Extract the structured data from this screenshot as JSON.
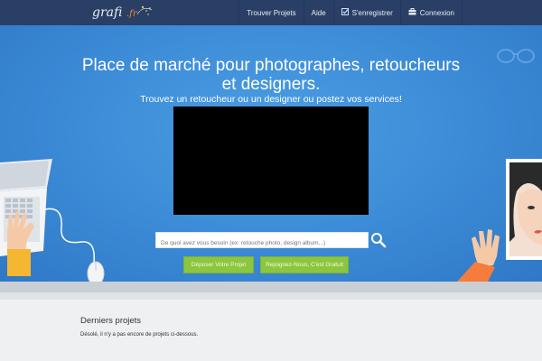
{
  "brand": {
    "logo_text": "grafi.fr"
  },
  "nav": {
    "items": [
      {
        "label": "Trouver Projets",
        "icon": ""
      },
      {
        "label": "Aide",
        "icon": ""
      },
      {
        "label": "S'enregistrer",
        "icon": "checkbox-icon"
      },
      {
        "label": "Connexion",
        "icon": "briefcase-icon"
      }
    ]
  },
  "hero": {
    "title_line1": "Place de marché pour photographes, retoucheurs",
    "title_line2": "et designers.",
    "subtitle": "Trouvez un retoucheur ou un designer ou postez vos services!"
  },
  "search": {
    "placeholder": "De quoi avez vous besoin (ex: retouche photo, design album...)",
    "value": ""
  },
  "buttons": {
    "post_project": "Déposer Votre Projet",
    "register": "Rejoignez-Nous, C'est Gratuit"
  },
  "projects": {
    "title": "Derniers projets",
    "empty_message": "Désolé, il n'y a pas encore de projets ci-dessous."
  },
  "colors": {
    "navbar": "#2a3f66",
    "hero_blue": "#3b8ad6",
    "button_green": "#8cc63f"
  }
}
